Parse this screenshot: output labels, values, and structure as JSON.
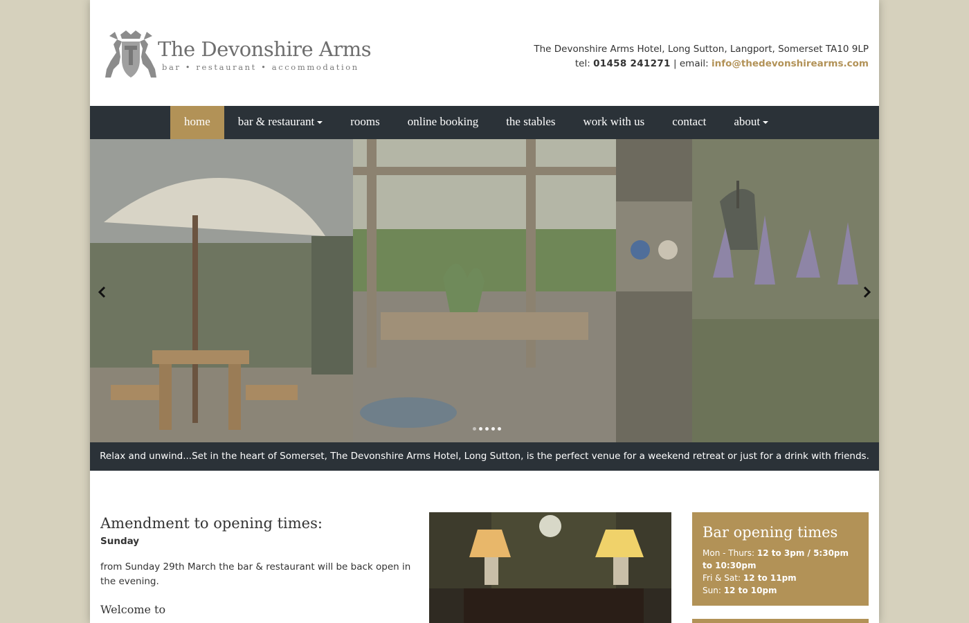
{
  "brand": {
    "name": "The Devonshire Arms",
    "tagline": "bar • restaurant • accommodation"
  },
  "contact": {
    "address": "The Devonshire Arms Hotel, Long Sutton, Langport, Somerset TA10 9LP",
    "tel_label": "tel:",
    "tel": "01458 241271",
    "separator": "|",
    "email_label": "email:",
    "email": "info@thedevonshirearms.com"
  },
  "nav": {
    "items": [
      {
        "label": "home",
        "active": true,
        "dropdown": false
      },
      {
        "label": "bar & restaurant",
        "active": false,
        "dropdown": true
      },
      {
        "label": "rooms",
        "active": false,
        "dropdown": false
      },
      {
        "label": "online booking",
        "active": false,
        "dropdown": false
      },
      {
        "label": "the stables",
        "active": false,
        "dropdown": false
      },
      {
        "label": "work with us",
        "active": false,
        "dropdown": false
      },
      {
        "label": "contact",
        "active": false,
        "dropdown": false
      },
      {
        "label": "about",
        "active": false,
        "dropdown": true
      }
    ]
  },
  "carousel": {
    "slide_count": 5,
    "active_index": 0,
    "prev_icon": "chevron-left-icon",
    "next_icon": "chevron-right-icon",
    "caption": "Relax and unwind...Set in the heart of Somerset, The Devonshire Arms Hotel, Long Sutton, is the perfect venue for a weekend retreat or just for a drink with friends."
  },
  "main": {
    "heading": "Amendment to opening times:",
    "day": "Sunday",
    "paragraph": "from Sunday 29th March the bar & restaurant will be back open in the evening.",
    "welcome": "Welcome to"
  },
  "hours": {
    "title": "Bar opening times",
    "rows": [
      {
        "days": "Mon - Thurs:",
        "times": "12 to 3pm / 5:30pm to 10:30pm"
      },
      {
        "days": "Fri & Sat:",
        "times": "12 to 11pm"
      },
      {
        "days": "Sun:",
        "times": "12 to 10pm"
      }
    ]
  },
  "colors": {
    "accent": "#b29257",
    "nav_bg": "#2b3238",
    "page_bg": "#d6d1bd"
  }
}
